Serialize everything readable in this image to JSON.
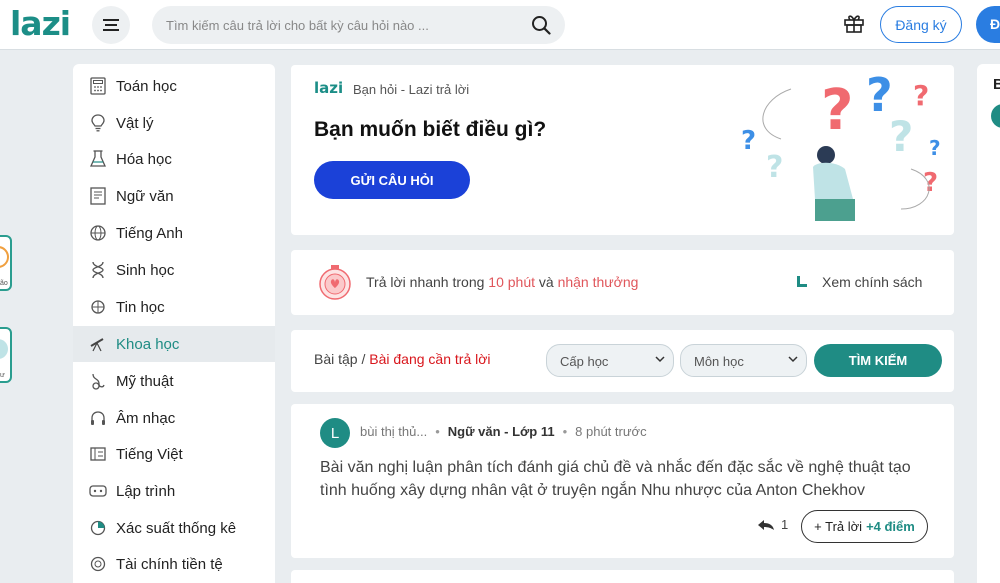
{
  "header": {
    "logo": "lazi",
    "search_placeholder": "Tìm kiếm câu trả lời cho bất kỳ câu hỏi nào ...",
    "register_label": "Đăng ký",
    "login_label": "Đ"
  },
  "sidebar": {
    "items": [
      {
        "label": "Toán học",
        "icon": "calculator-icon"
      },
      {
        "label": "Vật lý",
        "icon": "lightbulb-icon"
      },
      {
        "label": "Hóa học",
        "icon": "flask-icon"
      },
      {
        "label": "Ngữ văn",
        "icon": "book-icon"
      },
      {
        "label": "Tiếng Anh",
        "icon": "globe-icon"
      },
      {
        "label": "Sinh học",
        "icon": "dna-icon"
      },
      {
        "label": "Tin học",
        "icon": "chip-icon"
      },
      {
        "label": "Khoa học",
        "icon": "telescope-icon"
      },
      {
        "label": "Mỹ thuật",
        "icon": "palette-icon"
      },
      {
        "label": "Âm nhạc",
        "icon": "headphones-icon"
      },
      {
        "label": "Tiếng Việt",
        "icon": "text-icon"
      },
      {
        "label": "Lập trình",
        "icon": "code-icon"
      },
      {
        "label": "Xác suất thống kê",
        "icon": "chart-icon"
      },
      {
        "label": "Tài chính tiền tệ",
        "icon": "money-icon"
      }
    ],
    "active_index": 7
  },
  "hero": {
    "mini_logo": "lazi",
    "tagline": "Bạn hỏi - Lazi trả lời",
    "title": "Bạn muốn biết điều gì?",
    "send_button": "GỬI CÂU HỎI"
  },
  "promo": {
    "text_prefix": "Trả lời nhanh trong ",
    "highlight_time": "10 phút",
    "text_mid": " và ",
    "highlight_reward": "nhận thưởng",
    "policy_link": "Xem chính sách"
  },
  "filter": {
    "crumb_prefix": "Bài tập / ",
    "crumb_current": "Bài đang cần trả lời",
    "level_select": "Cấp học",
    "subject_select": "Môn học",
    "search_button": "TÌM KIẾM"
  },
  "question": {
    "avatar_letter": "L",
    "author": "bùi thị thủ...",
    "subject": "Ngữ văn - Lớp 11",
    "time": "8 phút trước",
    "text": "Bài văn nghị luận phân tích đánh giá chủ đề và nhắc đến đặc sắc về nghệ thuật tạo tình huống xây dựng nhân vật ở truyện ngắn Nhu nhược của Anton Chekhov",
    "reply_count": "1",
    "answer_label": "+ Trả lời",
    "points": "+4 điểm"
  },
  "right_panel": {
    "char": "B"
  },
  "edge": {
    "label1": "ão",
    "label2": "ư"
  },
  "colors": {
    "brand": "#1f8c84",
    "primary": "#1b41d8",
    "accent_red": "#e0565b"
  }
}
